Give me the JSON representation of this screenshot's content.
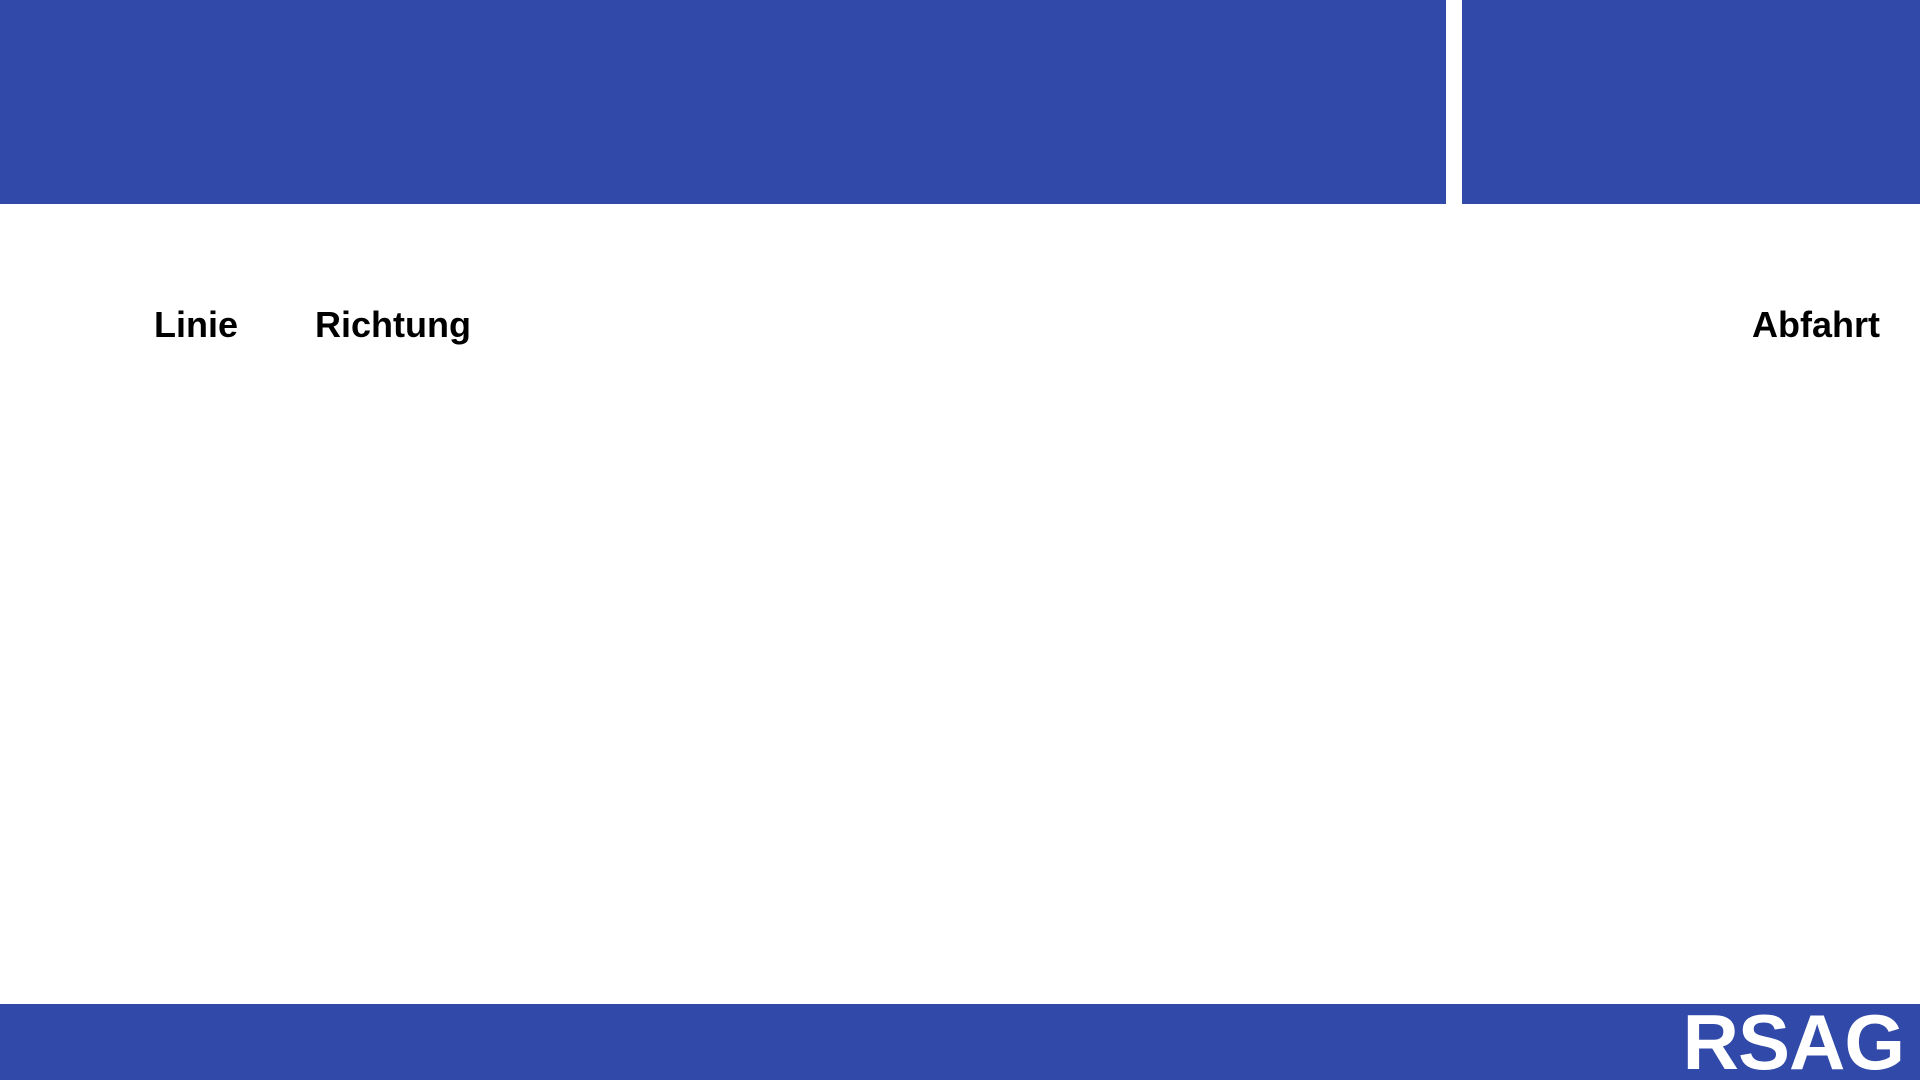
{
  "header": {
    "brand_color": "#314aa9"
  },
  "columns": {
    "line": "Linie",
    "direction": "Richtung",
    "departure": "Abfahrt"
  },
  "footer": {
    "logo_text": "RSAG"
  }
}
